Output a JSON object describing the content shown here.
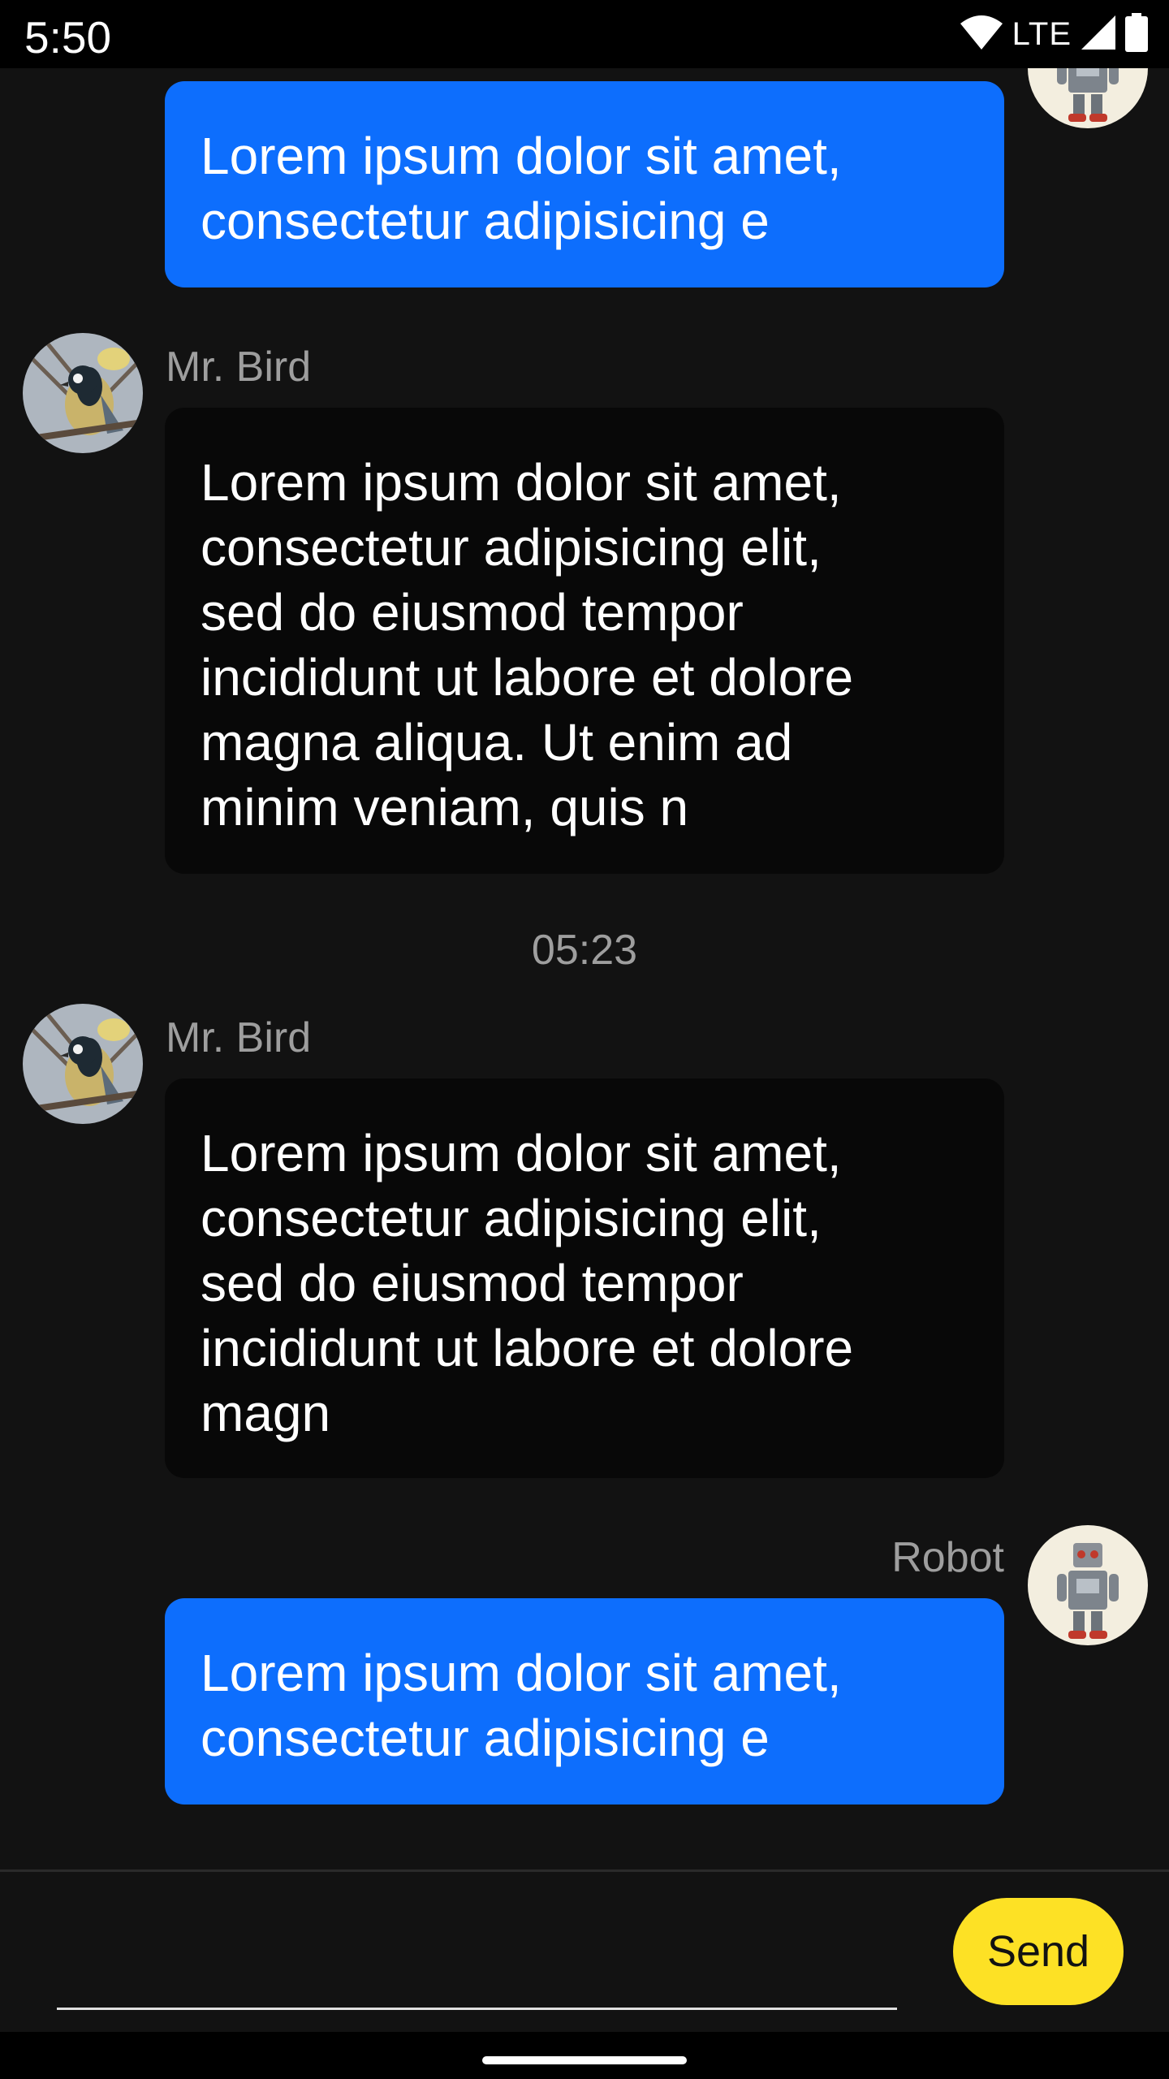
{
  "status_bar": {
    "time": "5:50",
    "network": "LTE",
    "icons": [
      "wifi-icon",
      "cell-signal-icon",
      "battery-icon"
    ]
  },
  "messages": [
    {
      "sender": "Robot",
      "sender_shown": false,
      "direction": "outgoing",
      "avatar": "robot-avatar",
      "text": "Lorem ipsum dolor sit amet,\nconsectetur adipisicing e"
    },
    {
      "sender": "Mr. Bird",
      "sender_shown": true,
      "direction": "incoming",
      "avatar": "bird-avatar",
      "text": "Lorem ipsum dolor sit amet,\nconsectetur adipisicing elit,\nsed do eiusmod tempor\nincididunt ut labore et dolore\nmagna aliqua. Ut enim ad\nminim veniam, quis n"
    },
    {
      "sender": "Mr. Bird",
      "sender_shown": true,
      "direction": "incoming",
      "avatar": "bird-avatar",
      "text": "Lorem ipsum dolor sit amet,\nconsectetur adipisicing elit,\nsed do eiusmod tempor\nincididunt ut labore et dolore\nmagn"
    },
    {
      "sender": "Robot",
      "sender_shown": true,
      "direction": "outgoing",
      "avatar": "robot-avatar",
      "text": "Lorem ipsum dolor sit amet,\nconsectetur adipisicing e"
    }
  ],
  "time_separator": "05:23",
  "composer": {
    "input_value": "",
    "placeholder": "",
    "send_label": "Send"
  },
  "colors": {
    "background": "#121212",
    "outgoing_bubble": "#0d6efd",
    "incoming_bubble": "#080808",
    "send_button": "#fde125",
    "secondary_text": "#9e9e9e"
  }
}
